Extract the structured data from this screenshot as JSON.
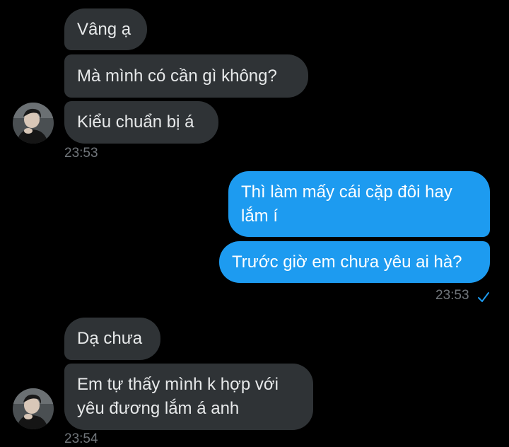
{
  "conversation": {
    "group1": {
      "messages": [
        "Vâng ạ",
        "Mà mình có cần gì không?",
        "Kiểu chuẩn bị á"
      ],
      "time": "23:53"
    },
    "group2": {
      "messages": [
        "Thì làm mấy cái cặp đôi hay\nlắm í",
        "Trước giờ em chưa yêu ai hà?"
      ],
      "time": "23:53",
      "status_icon": "check-icon"
    },
    "group3": {
      "messages": [
        "Dạ chưa",
        "Em tự thấy mình k hợp với\nyêu đương lắm á anh"
      ],
      "time": "23:54"
    }
  },
  "colors": {
    "background": "#000000",
    "incoming_bubble": "#2f3336",
    "outgoing_bubble": "#1d9bf0",
    "timestamp": "#71767b",
    "check": "#1d9bf0"
  }
}
